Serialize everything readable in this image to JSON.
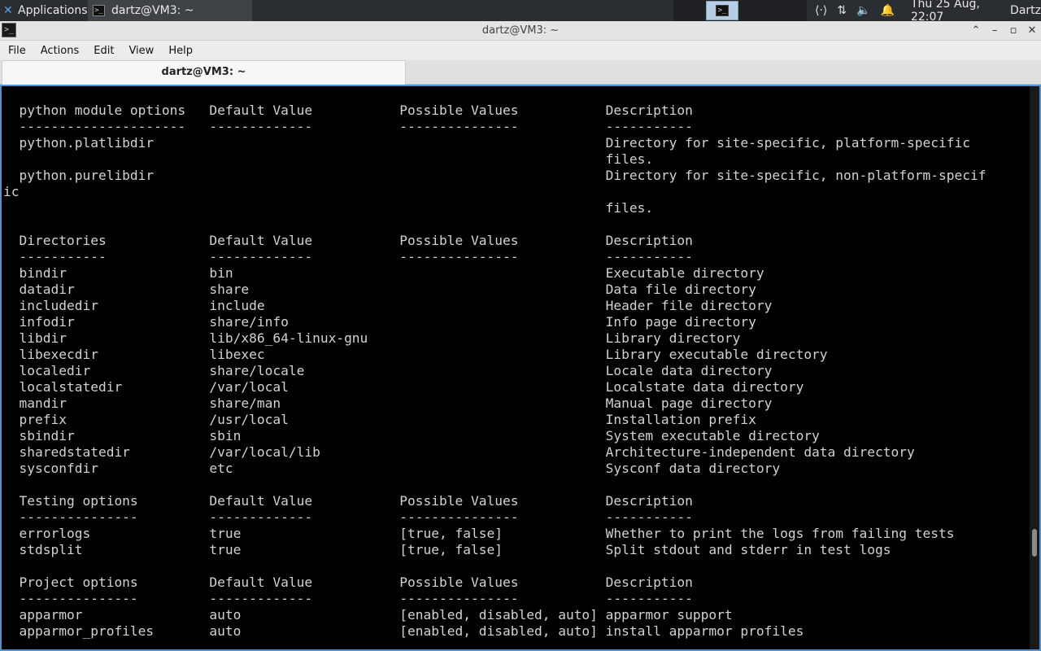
{
  "panel": {
    "applications_label": "Applications",
    "task_label": "dartz@VM3: ~",
    "clock": "Thu 25 Aug, 22:07",
    "user": "Dartz",
    "icons": [
      "xfce-logo-icon",
      "terminal-icon",
      "network-icon",
      "transfer-icon",
      "volume-icon",
      "bell-icon"
    ]
  },
  "window": {
    "title": "dartz@VM3: ~",
    "menu": [
      "File",
      "Actions",
      "Edit",
      "View",
      "Help"
    ],
    "tab_label": "dartz@VM3: ~"
  },
  "terminal": {
    "lines": [
      "  python module options   Default Value           Possible Values           Description",
      "  ---------------------   -------------           ---------------           -----------",
      "  python.platlibdir                                                         Directory for site-specific, platform-specific",
      "                                                                            files.",
      "  python.purelibdir                                                         Directory for site-specific, non-platform-specif",
      "ic",
      "                                                                            files.",
      "",
      "  Directories             Default Value           Possible Values           Description",
      "  -----------             -------------           ---------------           -----------",
      "  bindir                  bin                                               Executable directory",
      "  datadir                 share                                             Data file directory",
      "  includedir              include                                           Header file directory",
      "  infodir                 share/info                                        Info page directory",
      "  libdir                  lib/x86_64-linux-gnu                              Library directory",
      "  libexecdir              libexec                                           Library executable directory",
      "  localedir               share/locale                                      Locale data directory",
      "  localstatedir           /var/local                                        Localstate data directory",
      "  mandir                  share/man                                         Manual page directory",
      "  prefix                  /usr/local                                        Installation prefix",
      "  sbindir                 sbin                                              System executable directory",
      "  sharedstatedir          /var/local/lib                                    Architecture-independent data directory",
      "  sysconfdir              etc                                               Sysconf data directory",
      "",
      "  Testing options         Default Value           Possible Values           Description",
      "  ---------------         -------------           ---------------           -----------",
      "  errorlogs               true                    [true, false]             Whether to print the logs from failing tests",
      "  stdsplit                true                    [true, false]             Split stdout and stderr in test logs",
      "",
      "  Project options         Default Value           Possible Values           Description",
      "  ---------------         -------------           ---------------           -----------",
      "  apparmor                auto                    [enabled, disabled, auto] apparmor support",
      "  apparmor_profiles       auto                    [enabled, disabled, auto] install apparmor profiles"
    ]
  }
}
